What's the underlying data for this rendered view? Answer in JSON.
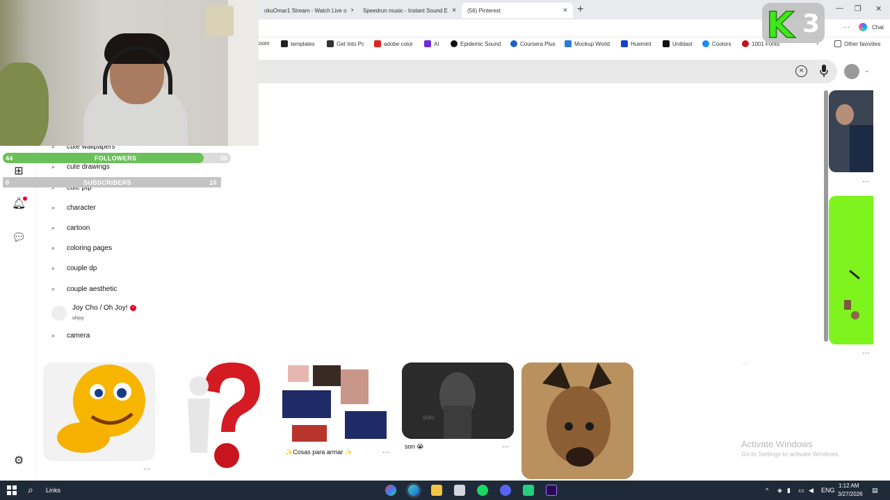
{
  "browser": {
    "tabs": [
      {
        "label": "okuOmar1 Stream - Watch Live o"
      },
      {
        "label": "Speedrun music - Instant Sound E"
      },
      {
        "label": "(56) Pinterest"
      }
    ],
    "bookmarks": [
      "oom",
      "templates",
      "Get Into Pc",
      "adobe color",
      "AI",
      "Epidemic Sound",
      "Coursera Plus",
      "Mockup World",
      "Huemint",
      "Uniblast",
      "Coolors",
      "1001 Fonts"
    ],
    "other_favorites": "Other favorites",
    "chat_label": "Chat"
  },
  "stream_overlay": {
    "followers": {
      "label": "FOLLOWERS",
      "current": "44",
      "goal": "50",
      "progress": 0.88
    },
    "subscribers": {
      "label": "SUBSCRIBERS",
      "current": "0",
      "goal": "10",
      "progress": 0
    },
    "logo_letter": "K",
    "logo_number": "3"
  },
  "search": {
    "suggestions": [
      "cute wallpapers",
      "cute drawings",
      "cute pfp",
      "character",
      "cartoon",
      "coloring pages",
      "couple dp",
      "couple aesthetic"
    ],
    "creator": {
      "name": "Joy Cho / Oh Joy!",
      "handle": "ohjoy"
    },
    "last_suggestion": "camera"
  },
  "pins": [
    {
      "caption": ""
    },
    {
      "caption": ""
    },
    {
      "caption": "✨Cosas para armar ✨"
    },
    {
      "caption": "son 😭",
      "overlay_text": "son"
    },
    {
      "caption": ""
    }
  ],
  "watermark": {
    "title": "Activate Windows",
    "subtitle": "Go to Settings to activate Windows."
  },
  "taskbar": {
    "search_label": "Links",
    "language": "ENG",
    "time": "1:12 AM",
    "date": "3/27/2026"
  },
  "colors": {
    "followers_fill": "#6cc05a",
    "pinterest_red": "#e60023",
    "lime_pin": "#7ef31e",
    "taskbar": "#1f2a38"
  }
}
